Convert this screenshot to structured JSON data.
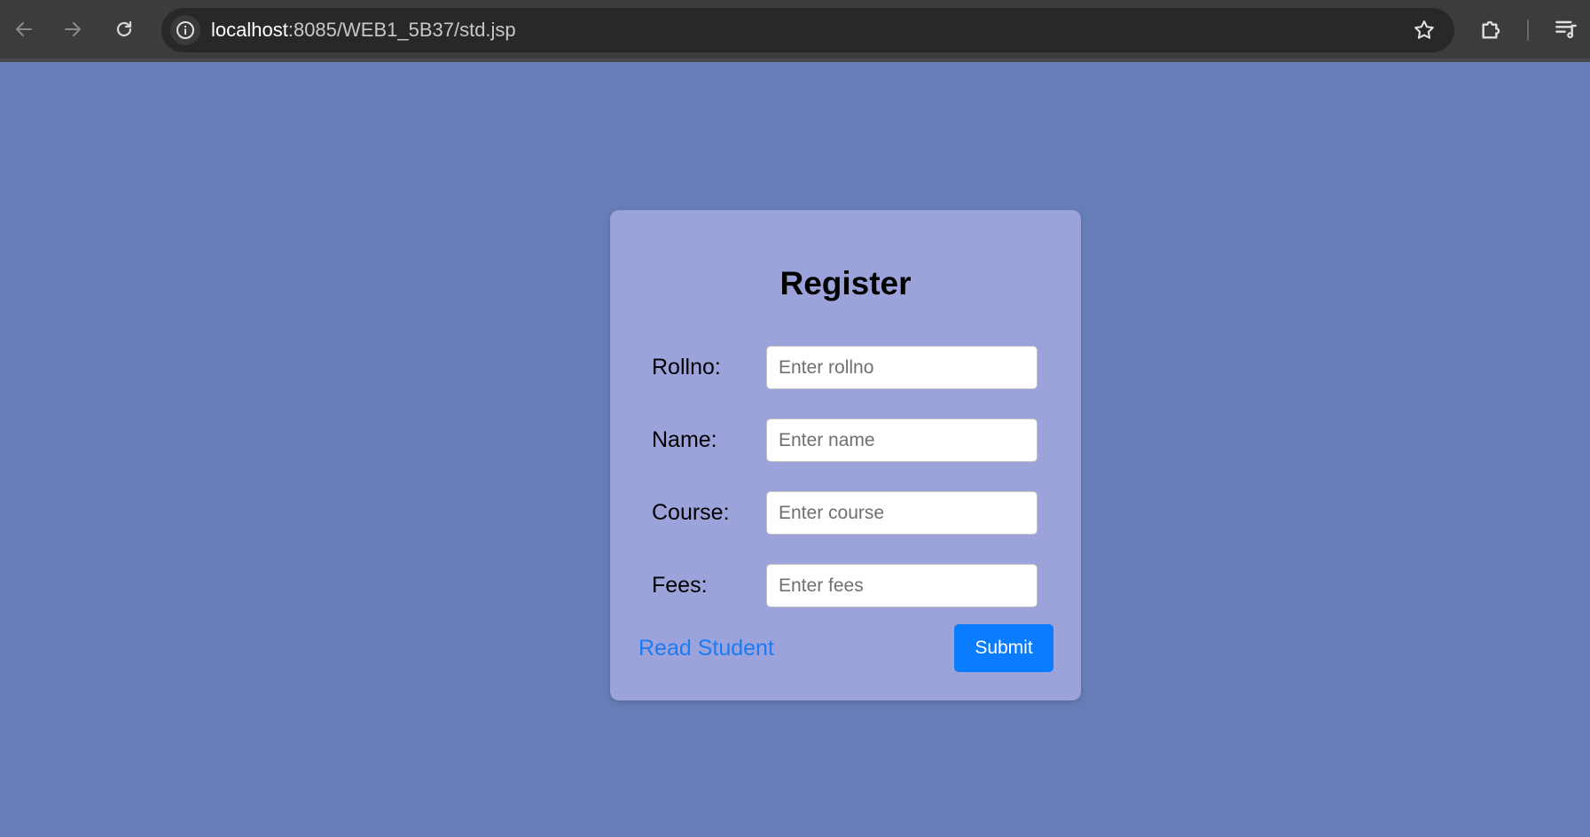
{
  "browser": {
    "url_host": "localhost",
    "url_rest": ":8085/WEB1_5B37/std.jsp",
    "icons": [
      "back-icon",
      "forward-icon",
      "reload-icon",
      "site-info-icon",
      "bookmark-star-icon",
      "extensions-icon",
      "reading-list-icon"
    ]
  },
  "form": {
    "title": "Register",
    "fields": [
      {
        "label": "Rollno:",
        "placeholder": "Enter rollno",
        "value": ""
      },
      {
        "label": "Name:",
        "placeholder": "Enter name",
        "value": ""
      },
      {
        "label": "Course:",
        "placeholder": "Enter course",
        "value": ""
      },
      {
        "label": "Fees:",
        "placeholder": "Enter fees",
        "value": ""
      }
    ],
    "link_label": "Read Student",
    "submit_label": "Submit"
  },
  "colors": {
    "page_background": "#667db7",
    "card_background": "#9ca3da",
    "link": "#1a7cf5",
    "submit_button": "#0a7cff",
    "toolbar": "#3c3c3c"
  }
}
